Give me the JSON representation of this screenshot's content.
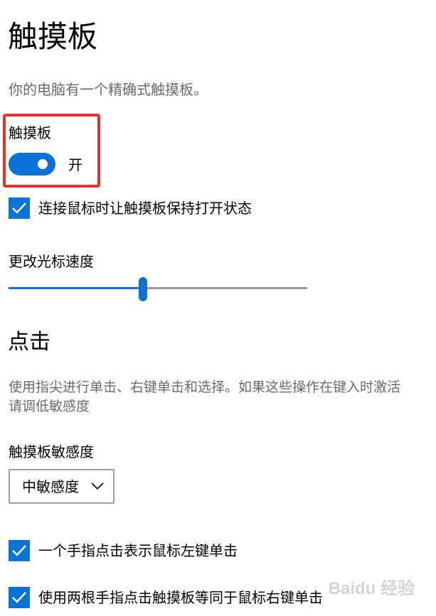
{
  "page": {
    "title": "触摸板",
    "intro": "你的电脑有一个精确式触摸板。"
  },
  "touchpad_toggle": {
    "label": "触摸板",
    "state_label": "开",
    "on": true
  },
  "keep_on_with_mouse": {
    "label": "连接鼠标时让触摸板保持打开状态",
    "checked": true
  },
  "cursor_speed": {
    "label": "更改光标速度",
    "value_fraction": 0.45
  },
  "tap_section": {
    "title": "点击",
    "description_lines": [
      "使用指尖进行单击、右键单击和选择。如果这些操作在键入时激活",
      "请调低敏感度"
    ],
    "sensitivity": {
      "label": "触摸板敏感度",
      "selected": "中敏感度"
    },
    "options": [
      {
        "label": "一个手指点击表示鼠标左键单击",
        "checked": true
      },
      {
        "label": "使用两根手指点击触摸板等同于鼠标右键单击",
        "checked": true
      }
    ]
  },
  "watermark": "Baidu 经验",
  "colors": {
    "accent": "#0a73d6",
    "highlight": "#e8302c",
    "secondary_text": "#6a6a6a",
    "track_off": "#9a9a9a"
  }
}
